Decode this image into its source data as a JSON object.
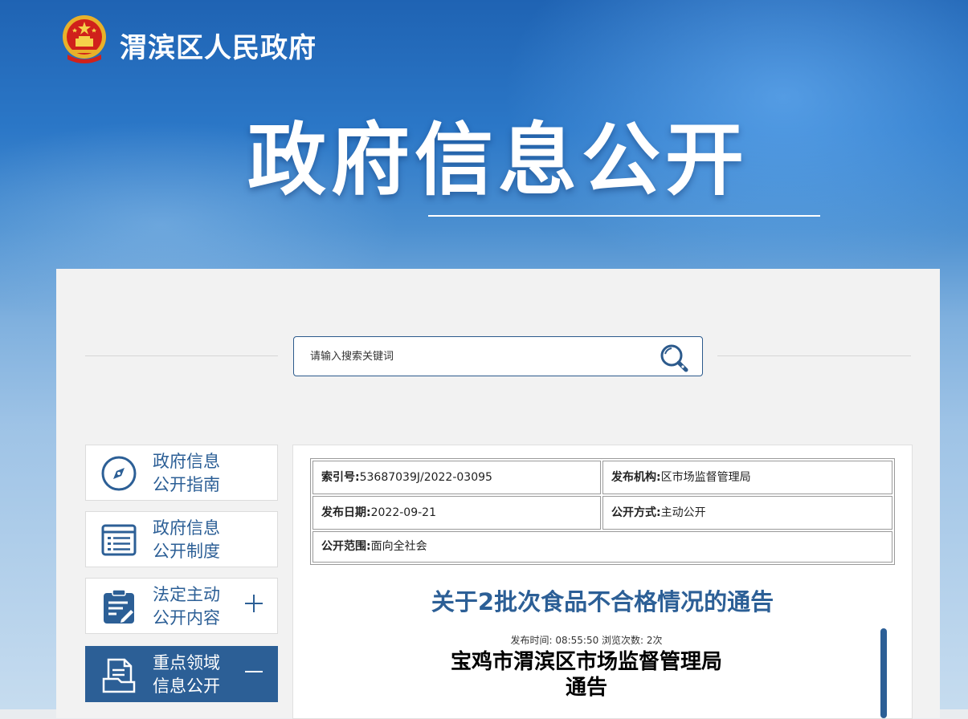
{
  "header": {
    "site_name": "渭滨区人民政府",
    "hero_title": "政府信息公开",
    "emblem_icon": "national-emblem-icon"
  },
  "search": {
    "placeholder": "请输入搜索关键词",
    "icon": "search-icon"
  },
  "sidebar": {
    "items": [
      {
        "label": "政府信息\n公开指南",
        "icon": "compass-icon",
        "active": false,
        "sign": ""
      },
      {
        "label": "政府信息\n公开制度",
        "icon": "list-document-icon",
        "active": false,
        "sign": ""
      },
      {
        "label": "法定主动\n公开内容",
        "icon": "clipboard-edit-icon",
        "active": false,
        "sign": "+"
      },
      {
        "label": "重点领域\n信息公开",
        "icon": "document-stack-icon",
        "active": true,
        "sign": "−"
      }
    ]
  },
  "meta": {
    "index_label": "索引号:",
    "index_value": "53687039J/2022-03095",
    "publisher_label": "发布机构:",
    "publisher_value": "区市场监督管理局",
    "date_label": "发布日期:",
    "date_value": "2022-09-21",
    "method_label": "公开方式:",
    "method_value": "主动公开",
    "scope_label": "公开范围:",
    "scope_value": "面向全社会"
  },
  "article": {
    "title": "关于2批次食品不合格情况的通告",
    "publish_time_label": "发布时间: ",
    "publish_time": "08:55:50",
    "views_label": " 浏览次数: ",
    "views": "2次",
    "doc_heading_line1": "宝鸡市渭滨区市场监督管理局",
    "doc_heading_line2": "通告"
  },
  "colors": {
    "primary": "#2c5f96",
    "banner_top": "#1f63b3",
    "panel_bg": "#f2f2f2"
  }
}
